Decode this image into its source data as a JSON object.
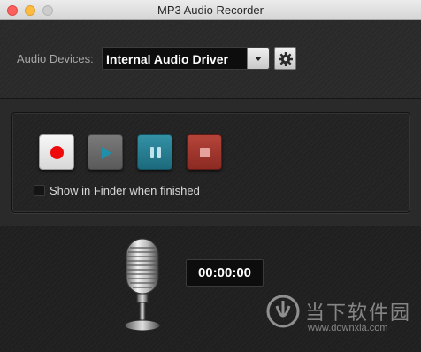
{
  "window": {
    "title": "MP3 Audio Recorder"
  },
  "devices": {
    "label": "Audio Devices:",
    "selected": "Internal Audio Driver",
    "settings_icon": "gear-icon"
  },
  "controls": {
    "record_icon": "record-icon",
    "play_icon": "play-icon",
    "pause_icon": "pause-icon",
    "stop_icon": "stop-icon",
    "show_in_finder_label": "Show in Finder when finished",
    "show_in_finder_checked": false
  },
  "recorder": {
    "timer": "00:00:00",
    "mic_icon": "microphone-icon"
  },
  "watermark": {
    "name": "当下软件园",
    "url": "www.downxia.com"
  },
  "colors": {
    "record": "#ee0a0a",
    "pause": "#2a7f93",
    "stop": "#9e362e",
    "play": "#1f8fab"
  }
}
